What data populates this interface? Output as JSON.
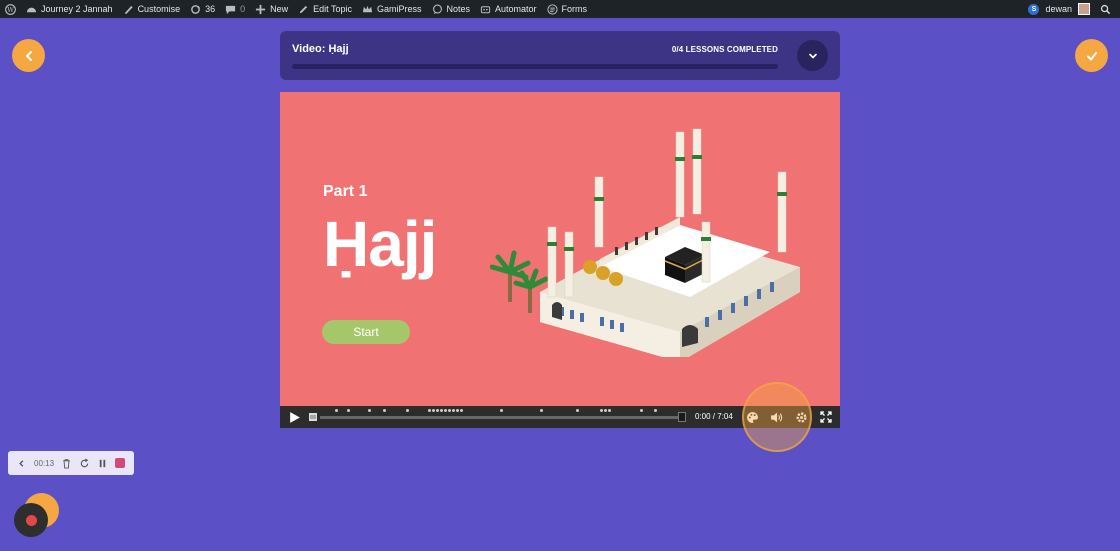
{
  "admin_bar": {
    "site_name": "Journey 2 Jannah",
    "customise": "Customise",
    "updates_count": "36",
    "comments_count": "0",
    "new": "New",
    "edit_topic": "Edit Topic",
    "gamipress": "GamiPress",
    "notes": "Notes",
    "automator": "Automator",
    "forms": "Forms",
    "user_name": "dewan"
  },
  "lesson": {
    "title": "Video: Ḥajj",
    "progress_text": "0/4 LESSONS COMPLETED",
    "progress_fraction": 0.0
  },
  "video": {
    "part_label": "Part 1",
    "title": "Ḥajj",
    "start_label": "Start",
    "time": "0:00 / 7:04",
    "played_fraction": 0.0
  },
  "recorder": {
    "elapsed": "00:13"
  },
  "colors": {
    "background": "#5b50c5",
    "accent": "#f5a742",
    "video_bg": "#f07272",
    "start_green": "#a5c769"
  }
}
